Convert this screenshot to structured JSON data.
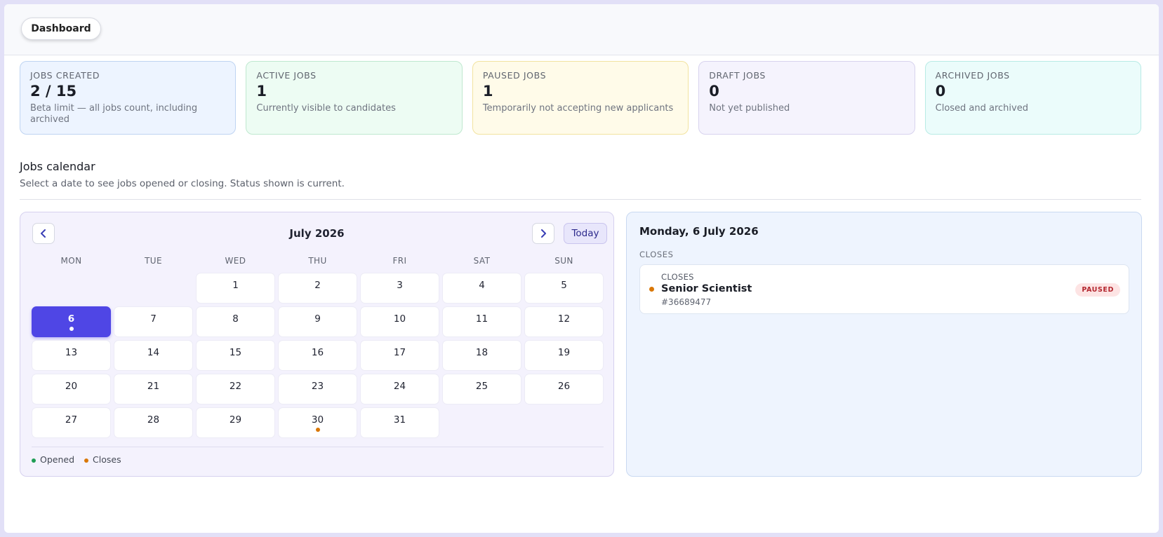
{
  "topbar": {
    "dashboard_label": "Dashboard"
  },
  "stats": [
    {
      "label": "JOBS CREATED",
      "value": "2 / 15",
      "desc": "Beta limit — all jobs count, including archived"
    },
    {
      "label": "ACTIVE JOBS",
      "value": "1",
      "desc": "Currently visible to candidates"
    },
    {
      "label": "PAUSED JOBS",
      "value": "1",
      "desc": "Temporarily not accepting new applicants"
    },
    {
      "label": "DRAFT JOBS",
      "value": "0",
      "desc": "Not yet published"
    },
    {
      "label": "ARCHIVED JOBS",
      "value": "0",
      "desc": "Closed and archived"
    }
  ],
  "section": {
    "title": "Jobs calendar",
    "subtitle": "Select a date to see jobs opened or closing. Status shown is current."
  },
  "calendar": {
    "month_label": "July 2026",
    "prev_icon": "chevron-left-icon",
    "next_icon": "chevron-right-icon",
    "today_label": "Today",
    "weekdays": [
      "MON",
      "TUE",
      "WED",
      "THU",
      "FRI",
      "SAT",
      "SUN"
    ],
    "leading_blanks": 2,
    "days_in_month": 31,
    "selected_day": 6,
    "markers": [
      {
        "day": 6,
        "type": "closes"
      },
      {
        "day": 30,
        "type": "closes"
      }
    ],
    "legend": [
      {
        "label": "Opened",
        "color": "#1f9d55"
      },
      {
        "label": "Closes",
        "color": "#d97706"
      }
    ]
  },
  "detail": {
    "date_label": "Monday, 6 July 2026",
    "group_label": "CLOSES",
    "jobs": [
      {
        "type": "CLOSES",
        "title": "Senior Scientist",
        "id": "#36689477",
        "status": "PAUSED"
      }
    ]
  },
  "colors": {
    "accent": "#4f46e5",
    "opened": "#1f9d55",
    "closes": "#d97706",
    "selected_dot": "#ffffff",
    "badge_paused_bg": "#fde4e4",
    "badge_paused_text": "#b3262e"
  }
}
